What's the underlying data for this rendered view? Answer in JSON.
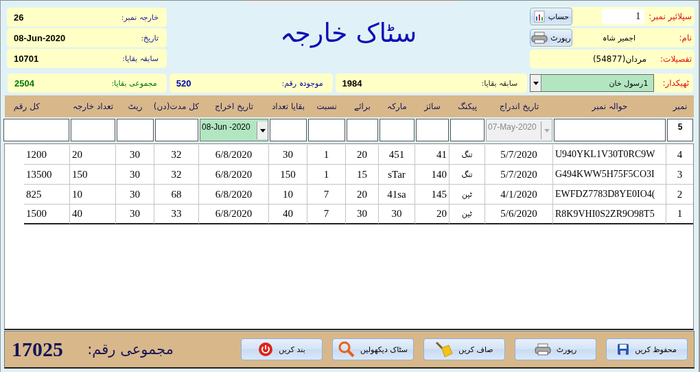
{
  "title": "سٹاک خارجہ",
  "supplier": {
    "number_label": "سپلائیر نمبر:",
    "number": "1",
    "account_button": "حساب",
    "name_label": "نام:",
    "name": "اجمیر شاہ",
    "report_button": "رپورٹ",
    "details_label": "تفصیلات:",
    "details": "مردان(54877)"
  },
  "info": [
    {
      "label": "خارجہ نمبر:",
      "value": "26"
    },
    {
      "label": "تاریخ:",
      "value": "08-Jun-2020"
    },
    {
      "label": "سابقہ بقایا:",
      "value": "10701"
    }
  ],
  "contractor": {
    "label": "ٹھیکدار:",
    "value": "1رسول خان"
  },
  "summary": [
    {
      "label": "سابقہ بقایا:",
      "value": "1984",
      "color": "#000000"
    },
    {
      "label": "موجودہ رقم:",
      "value": "520",
      "color": "#0000aa"
    },
    {
      "label": "مجموعی بقایا:",
      "value": "2504",
      "color": "#007700"
    }
  ],
  "table": {
    "columns": [
      "نمبر",
      "حوالہ نمبر",
      "تاریخ اندراج",
      "پیکنگ",
      "سائز",
      "مارکہ",
      "برائے",
      "نسبت",
      "بقایا تعداد",
      "تاریخ اخراج",
      "کل مدت(دن)",
      "ریٹ",
      "تعداد خارجہ",
      "کل رقم"
    ],
    "entry": [
      {
        "kind": "text",
        "value": "5"
      },
      {
        "kind": "text"
      },
      {
        "kind": "date",
        "value": "07-May-2020",
        "disabled": true
      },
      {
        "kind": "text"
      },
      {
        "kind": "text"
      },
      {
        "kind": "text"
      },
      {
        "kind": "text"
      },
      {
        "kind": "text"
      },
      {
        "kind": "text"
      },
      {
        "kind": "date",
        "value": "08-Jun -2020",
        "disabled": false
      },
      {
        "kind": "text"
      },
      {
        "kind": "text"
      },
      {
        "kind": "text"
      },
      {
        "kind": "text"
      }
    ],
    "rows": [
      [
        "4",
        "U940YKL1V30T0RC9W",
        "5/7/2020",
        "تنگ",
        "41",
        "451",
        "20",
        "1",
        "30",
        "6/8/2020",
        "32",
        "30",
        "20",
        "1200"
      ],
      [
        "3",
        "G494KWW5H75F5CO3I",
        "5/7/2020",
        "تنگ",
        "140",
        "sTar",
        "15",
        "1",
        "150",
        "6/8/2020",
        "32",
        "30",
        "150",
        "13500"
      ],
      [
        "2",
        "EWFDZ7783D8YE0IO4(",
        "4/1/2020",
        "ٹین",
        "145",
        "41sa",
        "20",
        "7",
        "10",
        "6/8/2020",
        "68",
        "30",
        "10",
        "825"
      ],
      [
        "1",
        "R8K9VHI0S2ZR9O98T5",
        "5/6/2020",
        "ٹین",
        "20",
        "30",
        "30",
        "7",
        "40",
        "6/8/2020",
        "33",
        "30",
        "40",
        "1500"
      ]
    ]
  },
  "footer": {
    "buttons": [
      {
        "kind": "save",
        "label": "محفوظ کریں"
      },
      {
        "kind": "printer",
        "label": "رپورٹ"
      },
      {
        "kind": "broom",
        "label": "صاف کریں"
      },
      {
        "kind": "search",
        "label": "سٹاک دیکھولیں"
      },
      {
        "kind": "power",
        "label": "بند کریں"
      }
    ],
    "total_label": "مجموعی رقم:",
    "total": "17025"
  }
}
